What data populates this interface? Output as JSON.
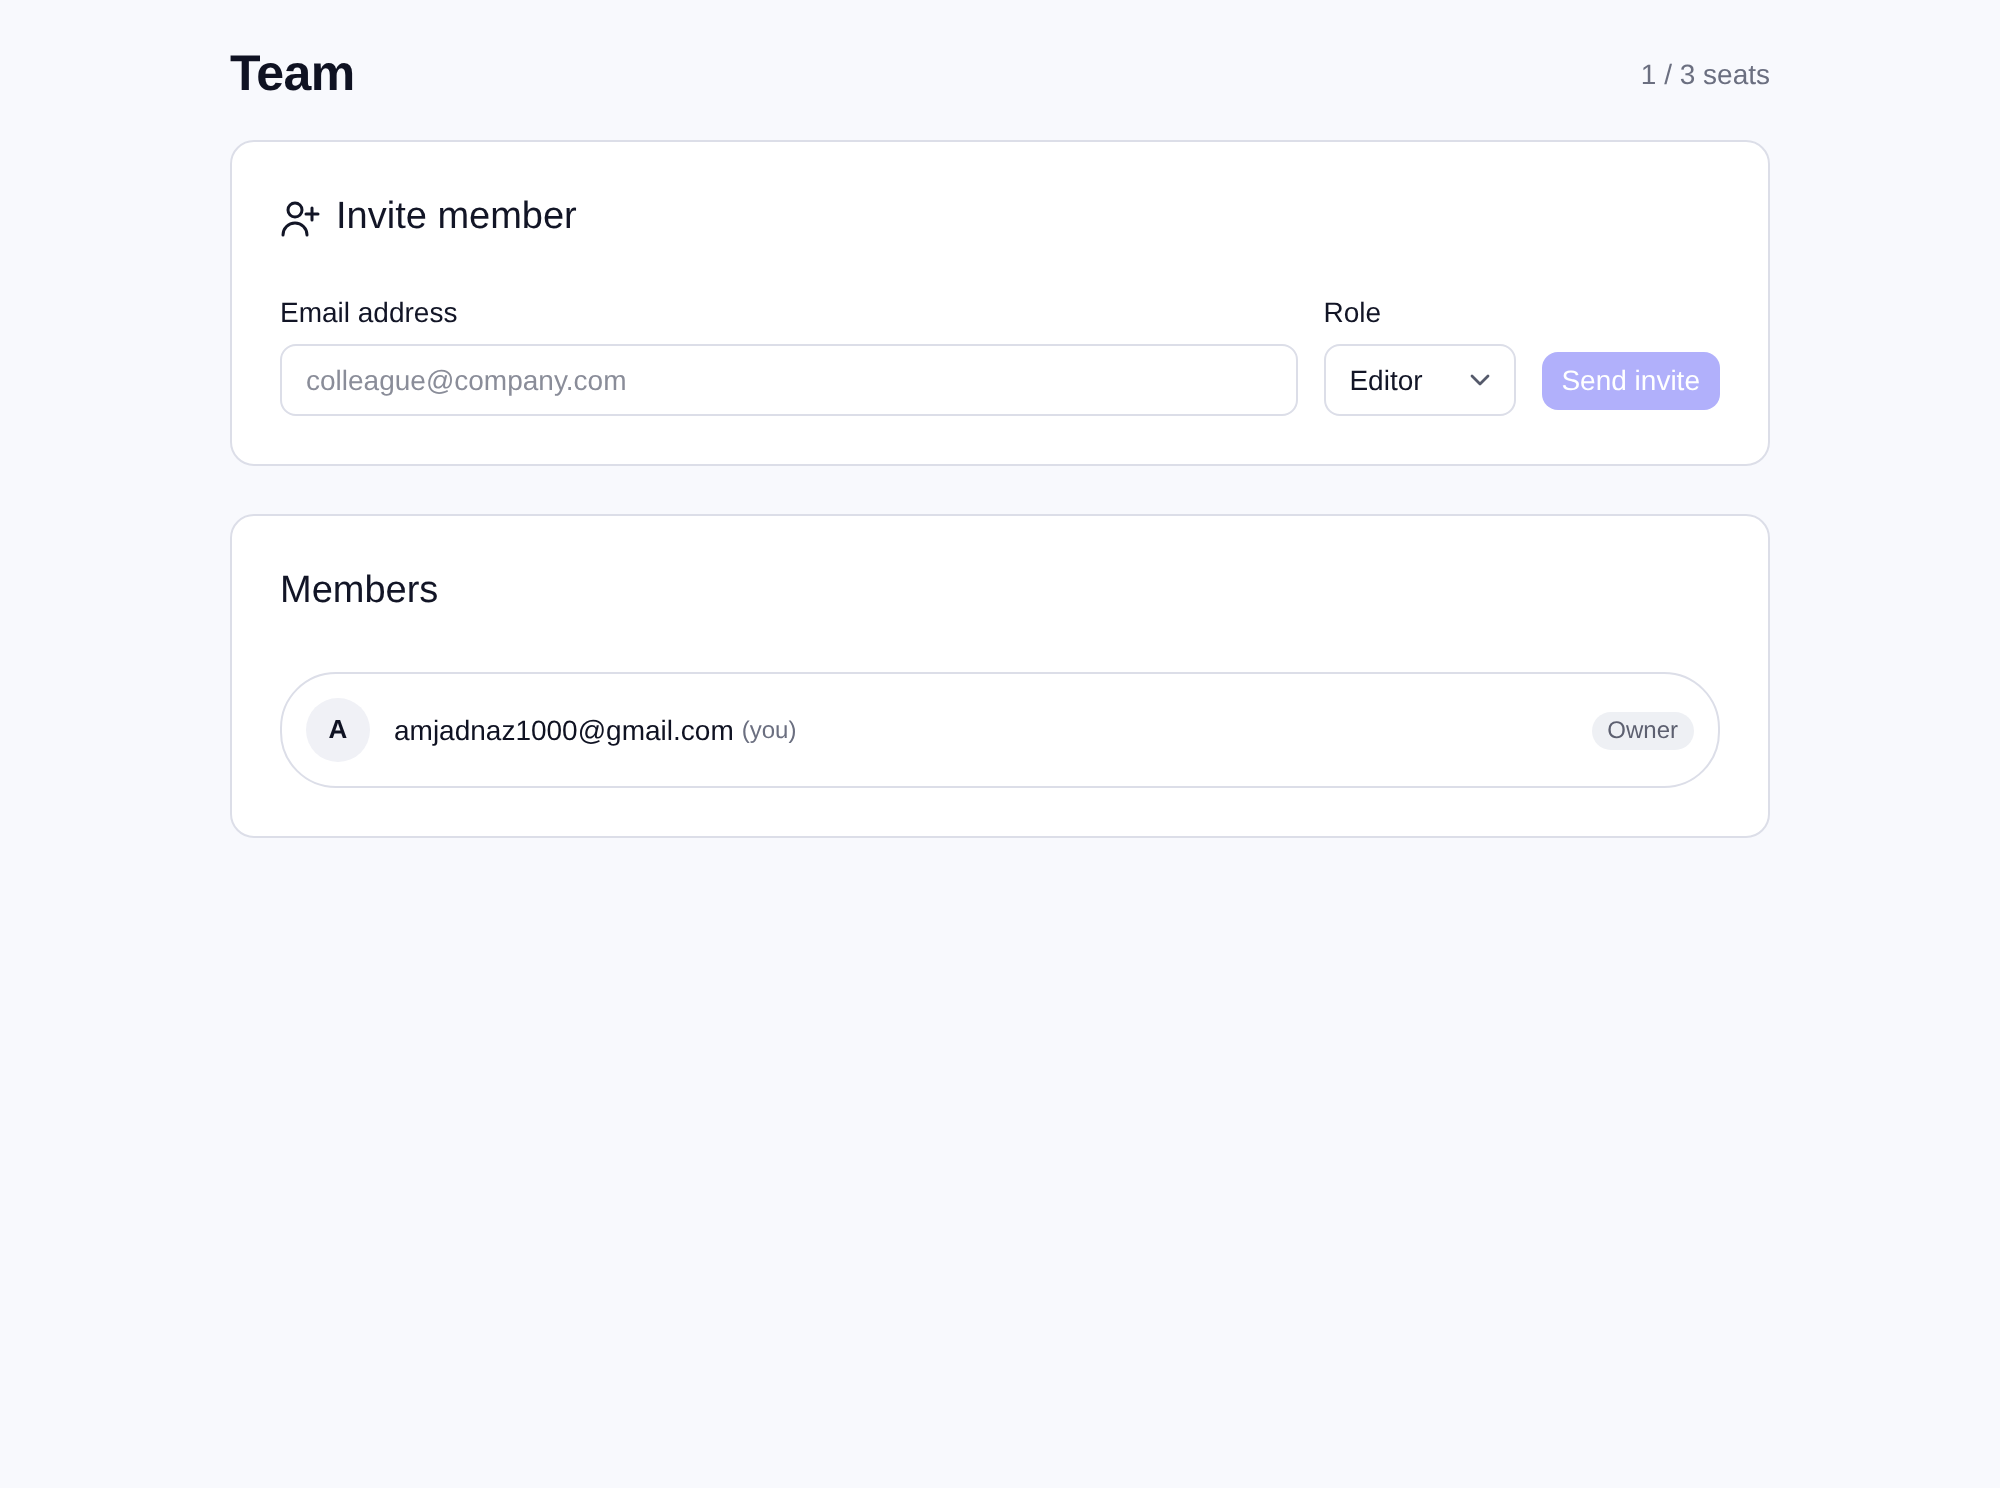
{
  "page": {
    "title": "Team",
    "seats": "1 / 3 seats"
  },
  "invite": {
    "title": "Invite member",
    "email": {
      "label": "Email address",
      "placeholder": "colleague@company.com"
    },
    "role": {
      "label": "Role",
      "value": "Editor"
    },
    "send_button": {
      "label": "Send invite",
      "disabled": true
    }
  },
  "members": {
    "title": "Members",
    "items": [
      {
        "avatar": "A",
        "email": "amjadnaz1000@gmail.com",
        "note": "(you)",
        "role": "Owner"
      }
    ]
  }
}
